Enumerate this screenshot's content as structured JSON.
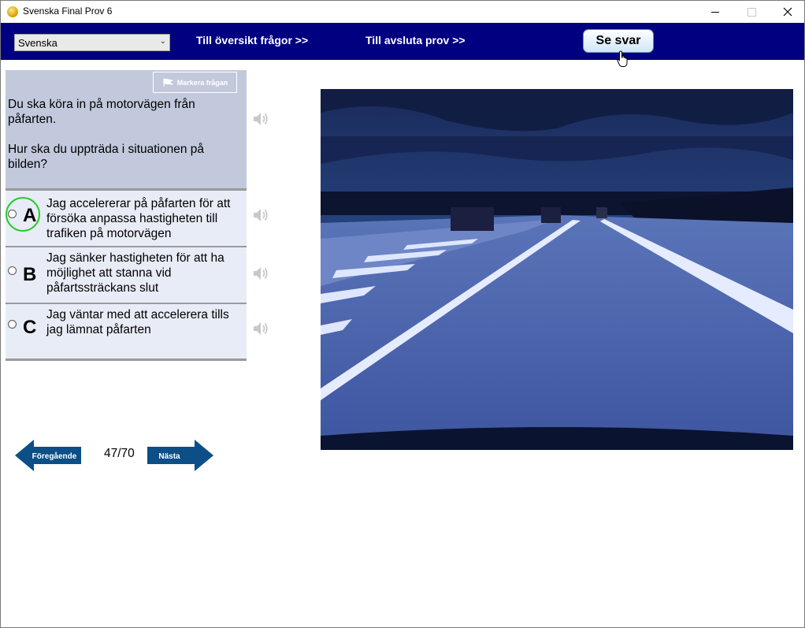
{
  "window": {
    "title": "Svenska Final Prov 6"
  },
  "topbar": {
    "language": "Svenska",
    "overview_link": "Till översikt frågor >>",
    "finish_link": "Till avsluta prov  >>",
    "show_answer": "Se svar"
  },
  "question": {
    "mark_label": "Markera frågan",
    "line1": "Du ska köra in på motorvägen från påfarten.",
    "line2": "Hur ska du uppträda i situationen på bilden?"
  },
  "answers": [
    {
      "letter": "A",
      "text": "Jag accelererar på påfarten för att försöka anpassa hastigheten till trafiken på motorvägen",
      "highlighted": true
    },
    {
      "letter": "B",
      "text": "Jag sänker hastigheten för att ha möjlighet att stanna vid påfartssträckans slut",
      "highlighted": false
    },
    {
      "letter": "C",
      "text": "Jag väntar med att accelerera tills jag lämnat påfarten",
      "highlighted": false
    }
  ],
  "navigation": {
    "prev_label": "Föregående",
    "next_label": "Nästa",
    "counter": "47/70"
  },
  "colors": {
    "topbar": "#000080",
    "question_bg": "#c2c9dc",
    "answer_bg": "#e8ecf6",
    "nav_arrow": "#0b4f86",
    "highlight_ring": "#22cc22"
  }
}
